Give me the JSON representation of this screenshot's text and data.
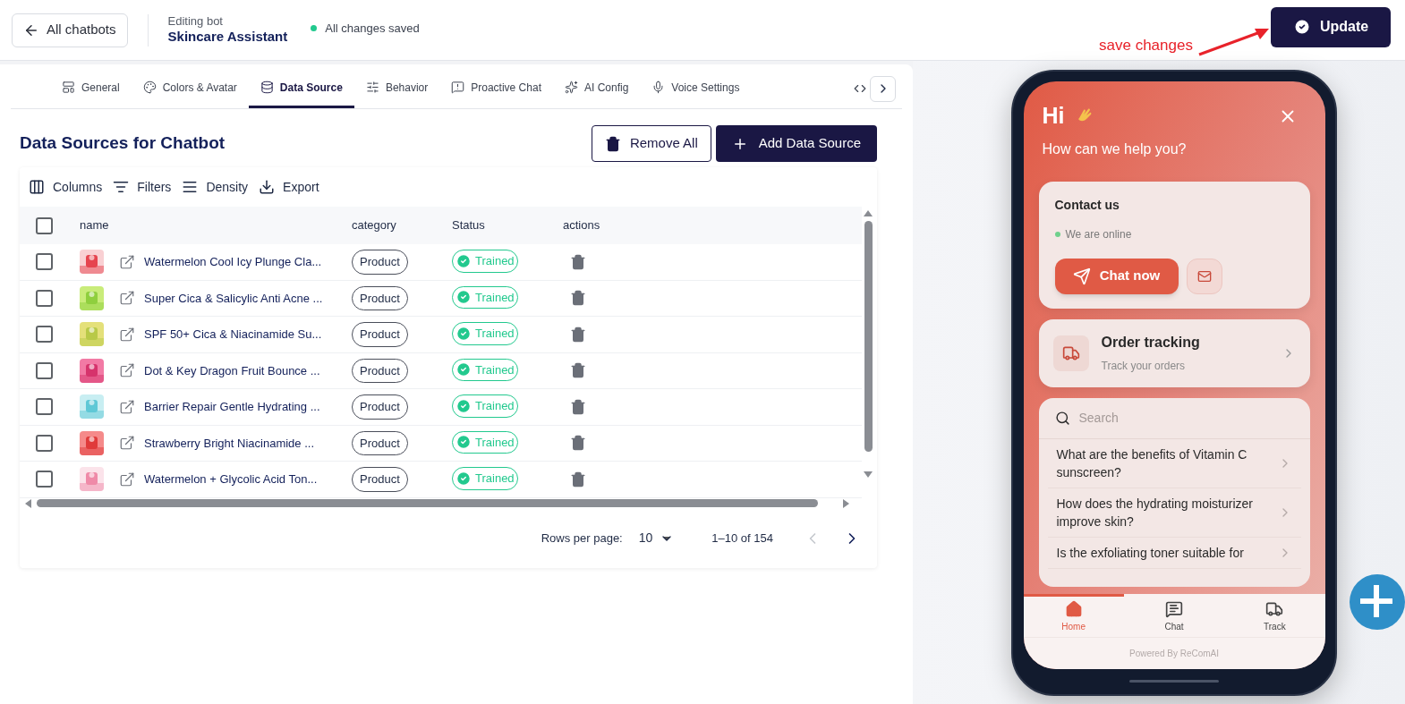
{
  "header": {
    "back_button": "All chatbots",
    "editing_label": "Editing bot",
    "bot_name": "Skincare Assistant",
    "save_status": "All changes saved",
    "saved": true,
    "update_button": "Update"
  },
  "annotation": {
    "text": "save changes"
  },
  "tabs": [
    {
      "label": "General",
      "selected": false
    },
    {
      "label": "Colors & Avatar",
      "selected": false
    },
    {
      "label": "Data Source",
      "selected": true
    },
    {
      "label": "Behavior",
      "selected": false
    },
    {
      "label": "Proactive Chat",
      "selected": false
    },
    {
      "label": "AI Config",
      "selected": false
    },
    {
      "label": "Voice Settings",
      "selected": false
    }
  ],
  "section_title": "Data Sources for Chatbot",
  "remove_all_button": "Remove All",
  "add_button": "Add Data Source",
  "toolbar": [
    "Columns",
    "Filters",
    "Density",
    "Export"
  ],
  "table": {
    "columns": [
      "name",
      "category",
      "Status",
      "actions"
    ],
    "all_checked": false,
    "rows": [
      {
        "name": "Watermelon Cool Icy Plunge Cla...",
        "category": "Product",
        "status": "Trained",
        "checked": false
      },
      {
        "name": "Super Cica & Salicylic Anti Acne ...",
        "category": "Product",
        "status": "Trained",
        "checked": false
      },
      {
        "name": "SPF 50+ Cica & Niacinamide Su...",
        "category": "Product",
        "status": "Trained",
        "checked": false
      },
      {
        "name": "Dot & Key Dragon Fruit Bounce ...",
        "category": "Product",
        "status": "Trained",
        "checked": false
      },
      {
        "name": "Barrier Repair Gentle Hydrating ...",
        "category": "Product",
        "status": "Trained",
        "checked": false
      },
      {
        "name": "Strawberry Bright Niacinamide ...",
        "category": "Product",
        "status": "Trained",
        "checked": false
      },
      {
        "name": "Watermelon + Glycolic Acid Ton...",
        "category": "Product",
        "status": "Trained",
        "checked": false
      }
    ]
  },
  "pagination": {
    "rows_per_page_label": "Rows per page:",
    "rows_per_page": "10",
    "range": "1–10 of 154",
    "prev_disabled": true,
    "next_disabled": false
  },
  "widget": {
    "greeting": "Hi",
    "subtitle": "How can we help you?",
    "contact": {
      "title": "Contact us",
      "status": "We are online",
      "online": true,
      "chat_button": "Chat now"
    },
    "order_tracking": {
      "title": "Order tracking",
      "subtitle": "Track your orders"
    },
    "search": {
      "placeholder": "Search"
    },
    "faqs": [
      "What are the benefits of Vitamin C sunscreen?",
      "How does the hydrating moisturizer improve skin?",
      "Is the exfoliating toner suitable for"
    ],
    "nav": [
      {
        "label": "Home",
        "selected": true
      },
      {
        "label": "Chat",
        "selected": false
      },
      {
        "label": "Track",
        "selected": false
      }
    ],
    "powered_by": "Powered By ReComAI"
  }
}
